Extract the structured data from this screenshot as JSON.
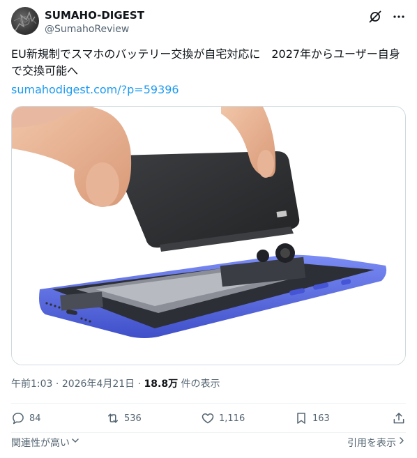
{
  "author": {
    "display_name": "SUMAHO-DIGEST",
    "handle": "@SumahoReview"
  },
  "post": {
    "text": "EU新規制でスマホのバッテリー交換が自宅対応に　2027年からユーザー自身で交換可能へ",
    "link": "sumahodigest.com/?p=59396",
    "time": "午前1:03",
    "sep1": " · ",
    "date": "2026年4月21日",
    "sep2": " · ",
    "views_count": "18.8万",
    "views_label": " 件の表示"
  },
  "metrics": {
    "replies": "84",
    "reposts": "536",
    "likes": "1,116",
    "bookmarks": "163"
  },
  "footer": {
    "sort_label": "関連性が高い",
    "quotes_label": "引用を表示"
  },
  "colors": {
    "link": "#1d9bf0",
    "muted": "#536471",
    "text": "#0f1419",
    "phone_blue": "#5a6de8"
  },
  "icons": [
    "grok-icon",
    "more-icon",
    "reply-icon",
    "repost-icon",
    "like-icon",
    "bookmark-icon",
    "share-icon",
    "chevron-down-icon"
  ]
}
